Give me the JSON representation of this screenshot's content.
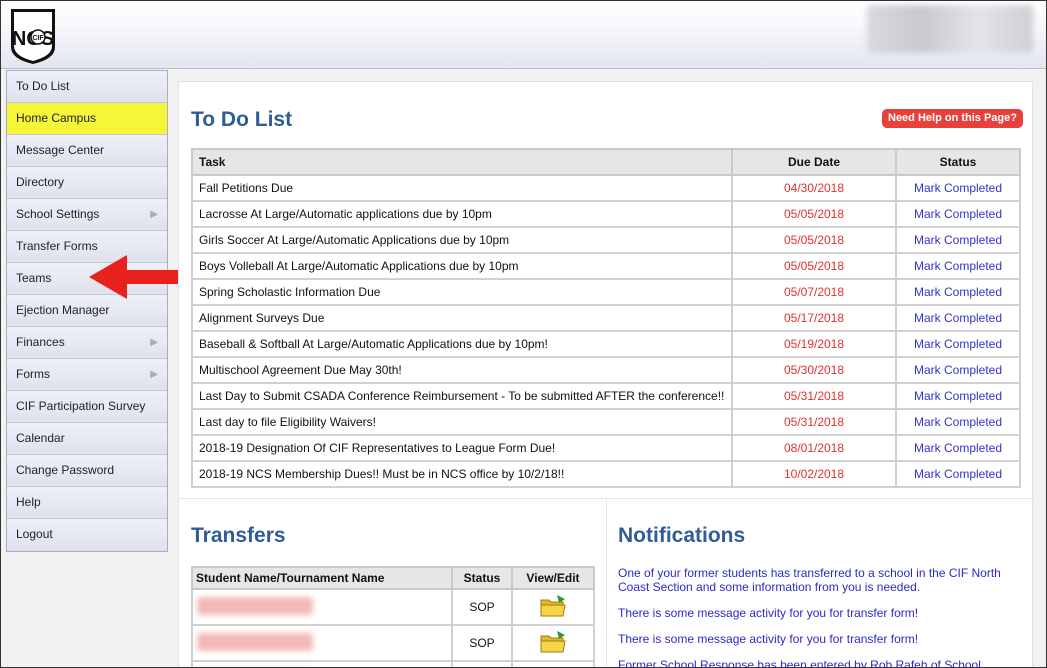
{
  "header": {
    "logo_text": "NCS",
    "logo_sub": "CIF"
  },
  "sidebar": {
    "items": [
      {
        "label": "To Do List",
        "active": false,
        "has_submenu": false
      },
      {
        "label": "Home Campus",
        "active": true,
        "has_submenu": false
      },
      {
        "label": "Message Center",
        "active": false,
        "has_submenu": false
      },
      {
        "label": "Directory",
        "active": false,
        "has_submenu": false
      },
      {
        "label": "School Settings",
        "active": false,
        "has_submenu": true
      },
      {
        "label": "Transfer Forms",
        "active": false,
        "has_submenu": false
      },
      {
        "label": "Teams",
        "active": false,
        "has_submenu": false
      },
      {
        "label": "Ejection Manager",
        "active": false,
        "has_submenu": false
      },
      {
        "label": "Finances",
        "active": false,
        "has_submenu": true
      },
      {
        "label": "Forms",
        "active": false,
        "has_submenu": true
      },
      {
        "label": "CIF Participation Survey",
        "active": false,
        "has_submenu": false
      },
      {
        "label": "Calendar",
        "active": false,
        "has_submenu": false
      },
      {
        "label": "Change Password",
        "active": false,
        "has_submenu": false
      },
      {
        "label": "Help",
        "active": false,
        "has_submenu": false
      },
      {
        "label": "Logout",
        "active": false,
        "has_submenu": false
      }
    ]
  },
  "todo": {
    "title": "To Do List",
    "help_label": "Need Help on this Page?",
    "columns": {
      "task": "Task",
      "due": "Due Date",
      "status": "Status"
    },
    "rows": [
      {
        "task": "Fall Petitions Due",
        "due": "04/30/2018",
        "status": "Mark Completed"
      },
      {
        "task": "Lacrosse At Large/Automatic applications due by 10pm",
        "due": "05/05/2018",
        "status": "Mark Completed"
      },
      {
        "task": "Girls Soccer At Large/Automatic Applications due by 10pm",
        "due": "05/05/2018",
        "status": "Mark Completed"
      },
      {
        "task": "Boys Volleball At Large/Automatic Applications due by 10pm",
        "due": "05/05/2018",
        "status": "Mark Completed"
      },
      {
        "task": "Spring Scholastic Information Due",
        "due": "05/07/2018",
        "status": "Mark Completed"
      },
      {
        "task": "Alignment Surveys Due",
        "due": "05/17/2018",
        "status": "Mark Completed"
      },
      {
        "task": "Baseball & Softball At Large/Automatic Applications due by 10pm!",
        "due": "05/19/2018",
        "status": "Mark Completed"
      },
      {
        "task": "Multischool Agreement Due May 30th!",
        "due": "05/30/2018",
        "status": "Mark Completed"
      },
      {
        "task": "Last Day to Submit CSADA Conference Reimbursement - To be submitted AFTER the conference!!",
        "due": "05/31/2018",
        "status": "Mark Completed"
      },
      {
        "task": "Last day to file Eligibility Waivers!",
        "due": "05/31/2018",
        "status": "Mark Completed"
      },
      {
        "task": "2018-19 Designation Of CIF Representatives to League Form Due!",
        "due": "08/01/2018",
        "status": "Mark Completed"
      },
      {
        "task": "2018-19 NCS Membership Dues!! Must be in NCS office by 10/2/18!!",
        "due": "10/02/2018",
        "status": "Mark Completed"
      }
    ]
  },
  "transfers": {
    "title": "Transfers",
    "columns": {
      "name": "Student Name/Tournament Name",
      "status": "Status",
      "view": "View/Edit"
    },
    "rows": [
      {
        "status": "SOP"
      },
      {
        "status": "SOP"
      },
      {
        "status": ""
      }
    ]
  },
  "notifications": {
    "title": "Notifications",
    "items": [
      "One of your former students has transferred to a school in the CIF North Coast Section and some information from you is needed.",
      "There is some message activity for you for transfer form!",
      "There is some message activity for you for transfer form!",
      "Former School Response has been entered by Rob Rafeh of School"
    ]
  },
  "colors": {
    "title_blue": "#2f5d98",
    "due_red": "#e03030",
    "link_blue": "#3333cc",
    "active_yellow": "#f5f53a",
    "help_red": "#e8413c"
  }
}
